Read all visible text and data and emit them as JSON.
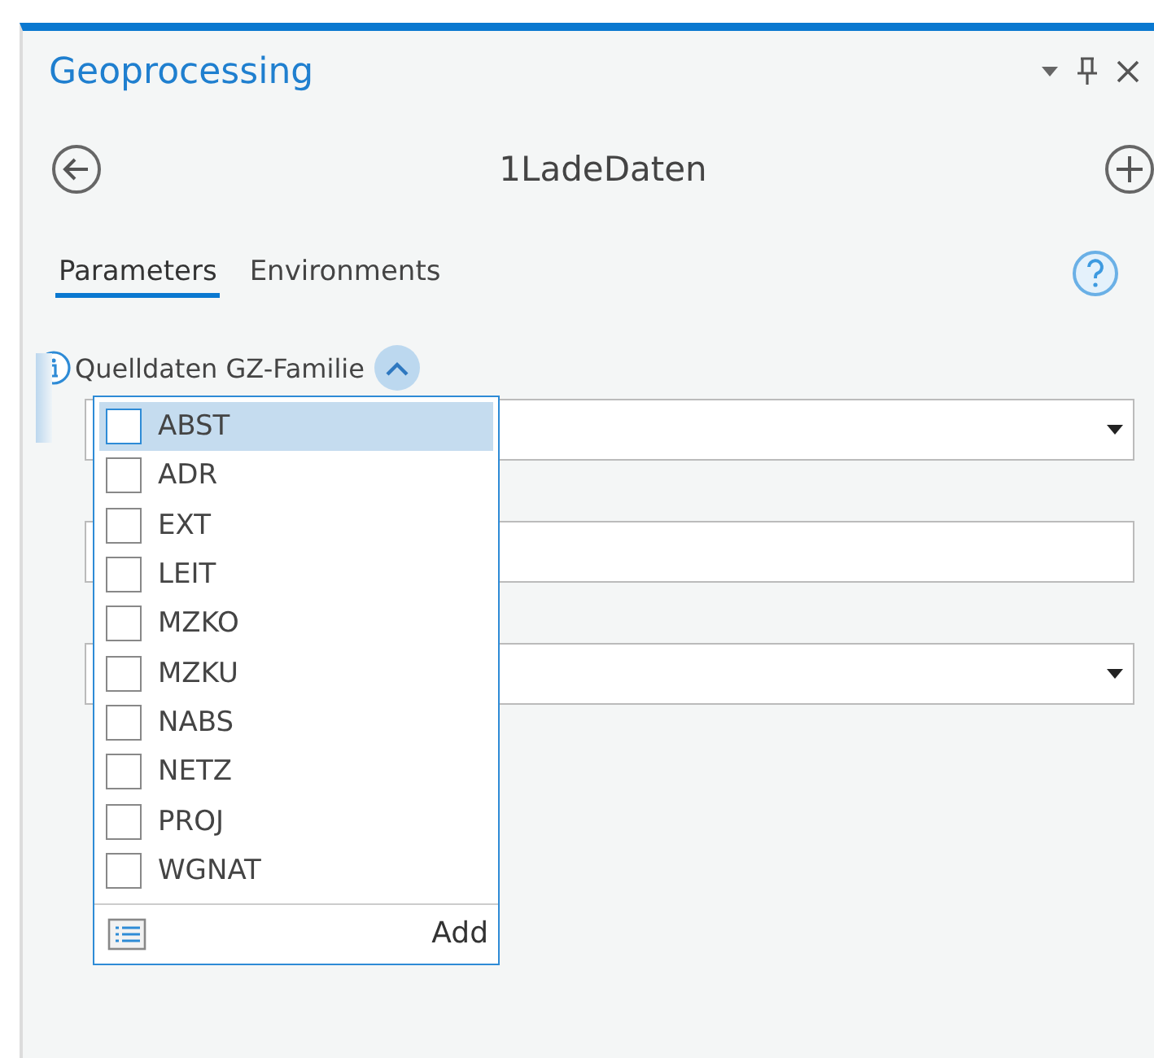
{
  "pane": {
    "title": "Geoprocessing",
    "tool_name": "1LadeDaten"
  },
  "tabs": [
    {
      "label": "Parameters",
      "selected": true
    },
    {
      "label": "Environments",
      "selected": false
    }
  ],
  "parameter": {
    "label": "Quelldaten GZ-Familie",
    "expanded": true
  },
  "fields": [
    {
      "kind": "dropdown"
    },
    {
      "kind": "text"
    },
    {
      "kind": "dropdown"
    }
  ],
  "popup": {
    "items": [
      {
        "label": "ABST",
        "checked": false,
        "selected": true
      },
      {
        "label": "ADR",
        "checked": false,
        "selected": false
      },
      {
        "label": "EXT",
        "checked": false,
        "selected": false
      },
      {
        "label": "LEIT",
        "checked": false,
        "selected": false
      },
      {
        "label": "MZKO",
        "checked": false,
        "selected": false
      },
      {
        "label": "MZKU",
        "checked": false,
        "selected": false
      },
      {
        "label": "NABS",
        "checked": false,
        "selected": false
      },
      {
        "label": "NETZ",
        "checked": false,
        "selected": false
      },
      {
        "label": "PROJ",
        "checked": false,
        "selected": false
      },
      {
        "label": "WGNAT",
        "checked": false,
        "selected": false
      }
    ],
    "add_label": "Add"
  }
}
